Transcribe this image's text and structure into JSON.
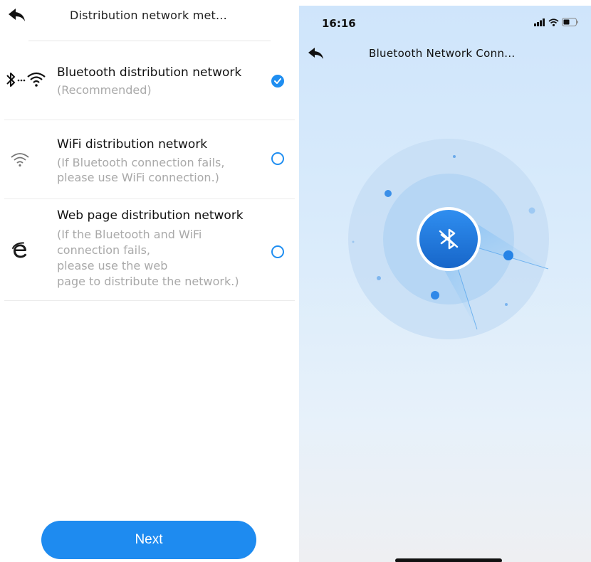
{
  "left": {
    "header": {
      "title": "Distribution network met..."
    },
    "options": [
      {
        "title": "Bluetooth distribution network",
        "subtitle": [
          "(Recommended)"
        ],
        "selected": true,
        "icon": "bluetooth-wifi-icon"
      },
      {
        "title": "WiFi distribution network",
        "subtitle": [
          "(If Bluetooth connection fails,",
          "please use WiFi connection.)"
        ],
        "selected": false,
        "icon": "wifi-icon"
      },
      {
        "title": "Web page distribution network",
        "subtitle": [
          "(If the Bluetooth and WiFi",
          "connection fails,",
          "please use the web",
          "page to distribute the network.)"
        ],
        "selected": false,
        "icon": "internet-explorer-icon"
      }
    ],
    "next_label": "Next"
  },
  "right": {
    "status": {
      "time": "16:16"
    },
    "header": {
      "title": "Bluetooth Network Conn..."
    }
  },
  "colors": {
    "accent": "#1e8bf0",
    "muted_text": "#a9a9a9"
  }
}
